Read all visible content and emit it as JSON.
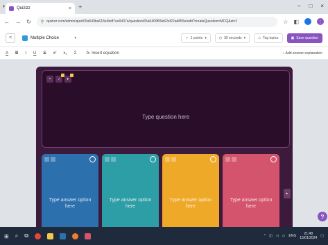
{
  "browser": {
    "tab_title": "Quizizz",
    "tab_close": "×",
    "new_tab": "+",
    "url": "quizizz.com/admin/quiz/65a540ba618e4bdf7ee9437a/question/65a5409f59e62ef22ad855e/edit?createQuestion=MCQ&at=1",
    "win_minimize": "–",
    "win_max": "□",
    "win_close": "×"
  },
  "editor": {
    "back": "<",
    "question_type": "Multiple Choice",
    "points": "1 points",
    "timer": "30 seconds",
    "tag_topics": "Tag topics",
    "save": "Save question"
  },
  "toolbar": {
    "items": [
      "A",
      "B",
      "I",
      "U",
      "S",
      "x²",
      "x₂",
      "Σ"
    ],
    "insert_equation": "Insert equation",
    "add_explanation": "Add answer explanation"
  },
  "question": {
    "placeholder": "Type question here"
  },
  "options": [
    {
      "placeholder": "Type answer option here",
      "color": "#2d70ae"
    },
    {
      "placeholder": "Type answer option here",
      "color": "#2d9da6"
    },
    {
      "placeholder": "Type answer option here",
      "color": "#efa929"
    },
    {
      "placeholder": "Type answer option here",
      "color": "#d5546d"
    }
  ],
  "help_label": "?",
  "taskbar": {
    "time": "21:48",
    "date": "15/01/2024",
    "lang": "ENG"
  },
  "colors": {
    "accent": "#8854c0",
    "canvas": "#3c1a3b",
    "taskbar": "#1f2a3d"
  }
}
